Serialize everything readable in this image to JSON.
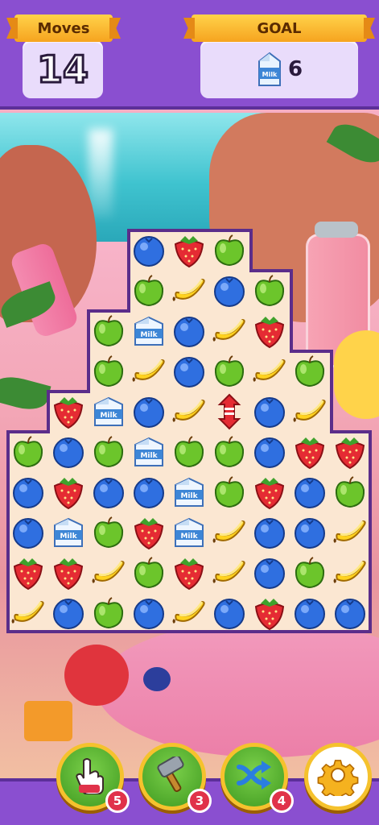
{
  "hud": {
    "moves_label": "Moves",
    "moves_value": "14",
    "goal_label": "GOAL",
    "goal_item_icon": "milk-carton-icon",
    "goal_item_text": "Milk",
    "goal_count": "6"
  },
  "board": {
    "rows": [
      [
        "",
        "",
        "",
        "blueberry",
        "strawberry",
        "apple",
        "",
        "",
        ""
      ],
      [
        "",
        "",
        "",
        "apple",
        "banana",
        "blueberry",
        "apple",
        "",
        ""
      ],
      [
        "",
        "",
        "apple",
        "milk",
        "blueberry",
        "banana",
        "strawberry",
        "",
        ""
      ],
      [
        "",
        "",
        "apple",
        "banana",
        "blueberry",
        "apple",
        "banana",
        "apple",
        ""
      ],
      [
        "",
        "strawberry",
        "milk",
        "blueberry",
        "banana",
        "rocket",
        "blueberry",
        "banana",
        ""
      ],
      [
        "apple",
        "blueberry",
        "apple",
        "milk",
        "apple",
        "apple",
        "blueberry",
        "strawberry",
        "strawberry"
      ],
      [
        "blueberry",
        "strawberry",
        "blueberry",
        "blueberry",
        "milk",
        "apple",
        "strawberry",
        "blueberry",
        "apple"
      ],
      [
        "blueberry",
        "milk",
        "apple",
        "strawberry",
        "milk",
        "banana",
        "blueberry",
        "blueberry",
        "banana"
      ],
      [
        "strawberry",
        "strawberry",
        "banana",
        "apple",
        "strawberry",
        "banana",
        "blueberry",
        "apple",
        "banana"
      ],
      [
        "banana",
        "blueberry",
        "apple",
        "blueberry",
        "banana",
        "blueberry",
        "strawberry",
        "blueberry",
        "blueberry"
      ]
    ],
    "milk_label": "Milk"
  },
  "boosters": [
    {
      "icon": "hand-tap-icon",
      "count": "5"
    },
    {
      "icon": "hammer-icon",
      "count": "3"
    },
    {
      "icon": "shuffle-icon",
      "count": "4"
    }
  ],
  "settings_icon": "gear-icon",
  "colors": {
    "bar": "#8a4fd0",
    "banner": "#f6a41f",
    "booster_ring": "#f5c22d",
    "badge": "#e0324a"
  }
}
